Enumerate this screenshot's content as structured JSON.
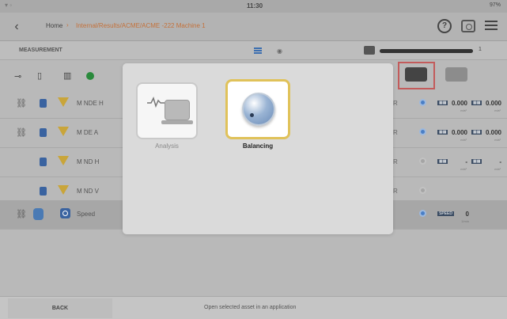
{
  "status_bar": {
    "clock": "11:30",
    "battery": "97%"
  },
  "nav": {
    "home": "Home",
    "separator": "›",
    "path": "Internal/Results/ACME/ACME -222 Machine 1"
  },
  "measurement": {
    "title": "MEASUREMENT",
    "page_number": "1"
  },
  "rows": [
    {
      "label": "M NDE H",
      "channel": "R",
      "v1": "0.000",
      "v2": "0.000",
      "unit": "m/s²"
    },
    {
      "label": "M DE A",
      "channel": "R",
      "v1": "0.000",
      "v2": "0.000",
      "unit": "m/s²"
    },
    {
      "label": "M ND H",
      "channel": "R",
      "v1": "-",
      "v2": "-",
      "unit": "m/s²"
    },
    {
      "label": "M ND V",
      "channel": "R"
    },
    {
      "label": "Speed",
      "speed_tag": "SPEED",
      "speed_value": "0",
      "speed_unit": "1/min"
    }
  ],
  "modal": {
    "apps": [
      {
        "name": "Analysis",
        "enabled": false,
        "icon": "motor-vibration-icon"
      },
      {
        "name": "Balancing",
        "enabled": true,
        "selected": true,
        "icon": "balancing-knob-icon"
      }
    ]
  },
  "footer": {
    "back_label": "BACK",
    "hint": "Open selected asset in an application"
  },
  "colors": {
    "accent": "#e0c25a",
    "warning": "#c9a53a",
    "selected_machine": "#c35b5b",
    "brand_blue": "#3a63a0"
  }
}
